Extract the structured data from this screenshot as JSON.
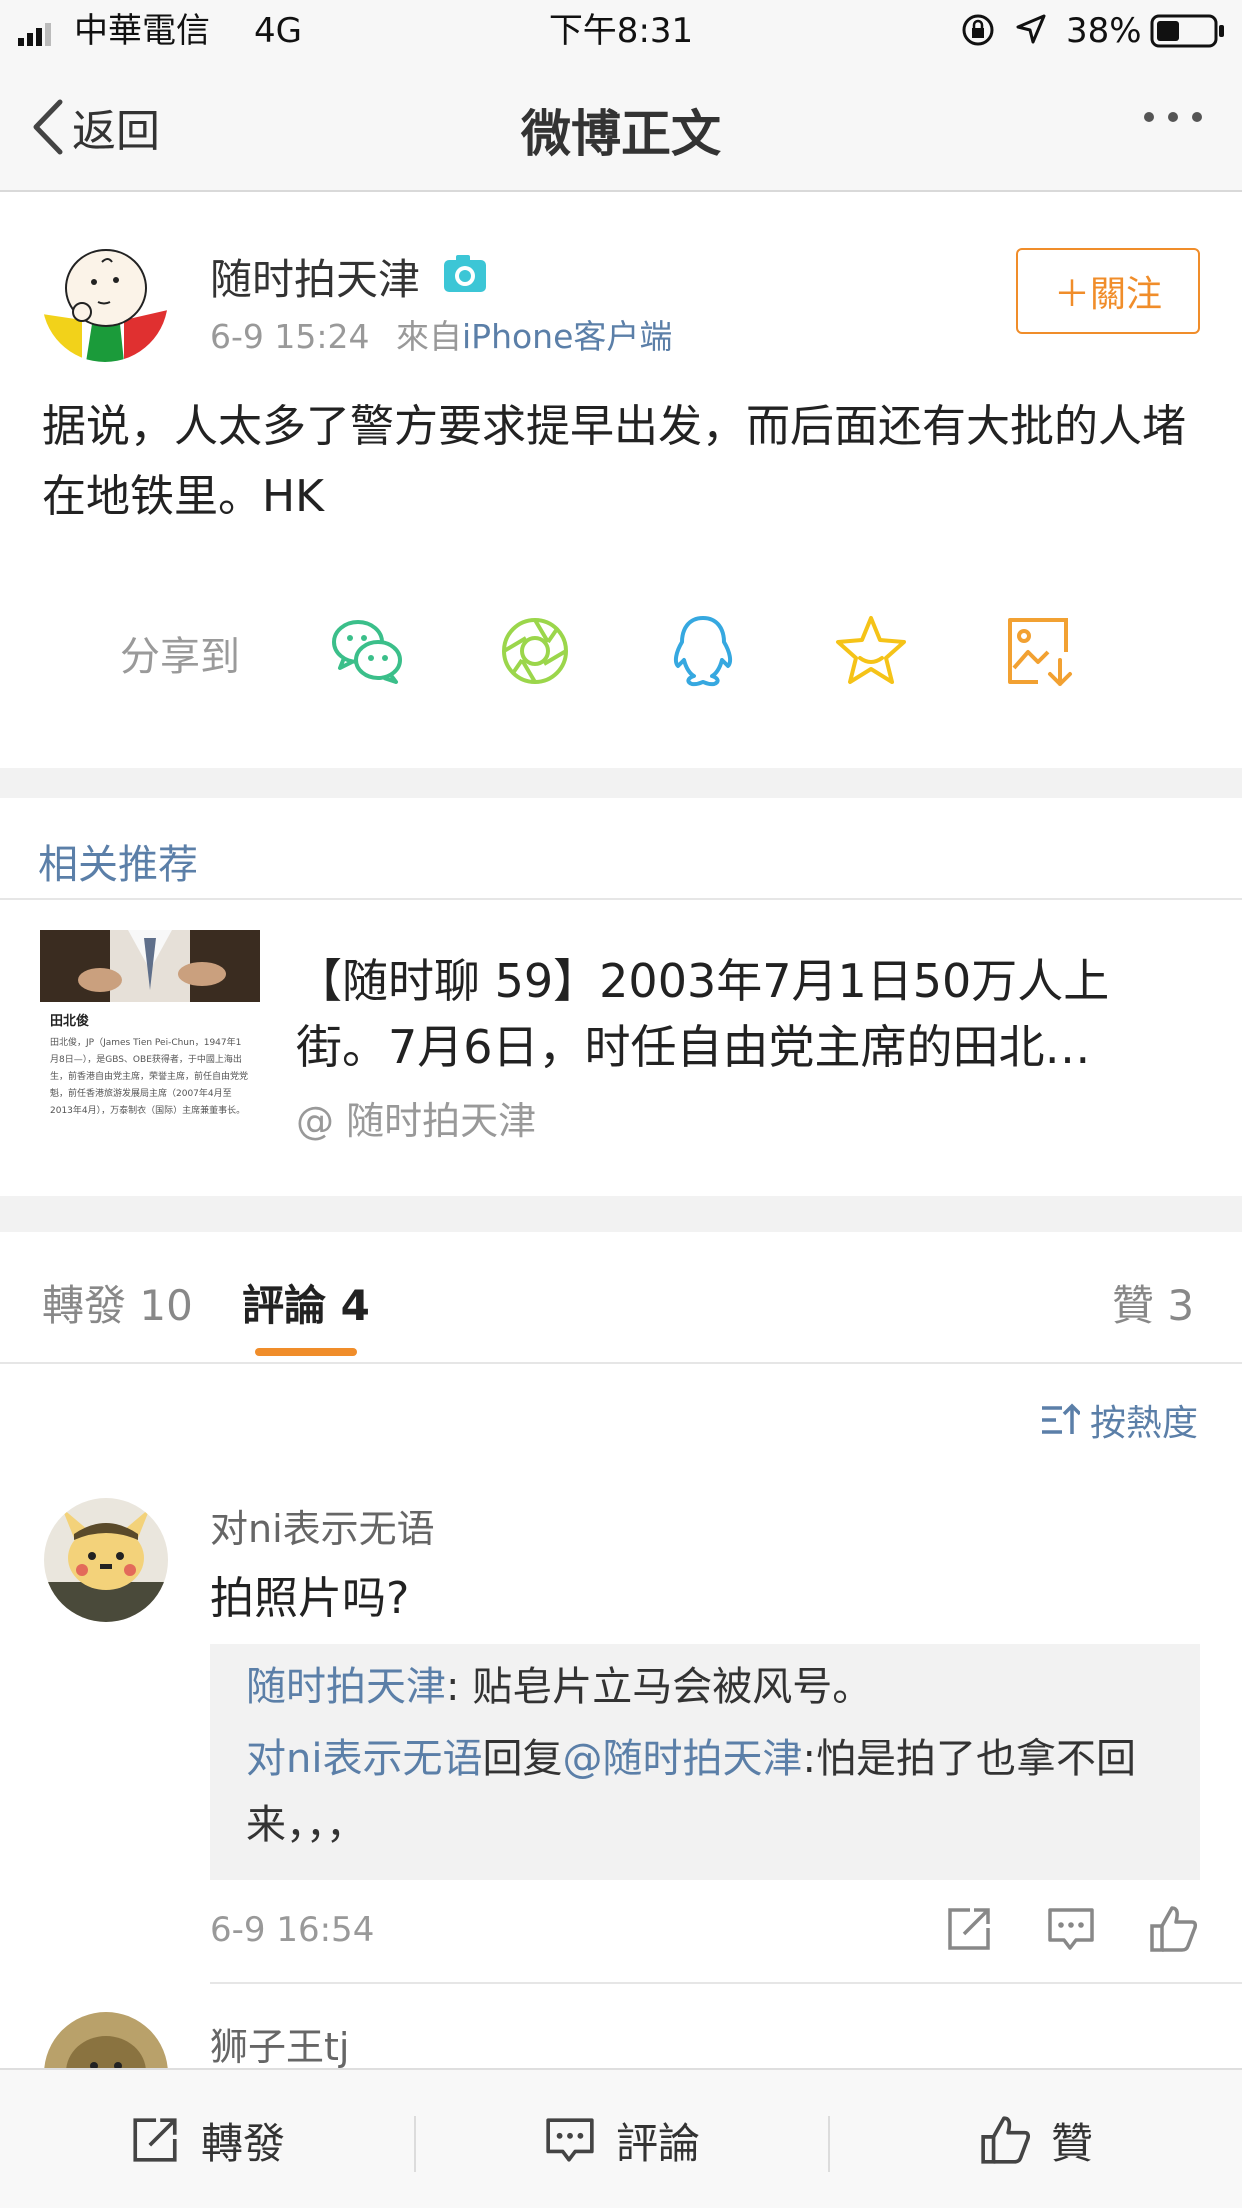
{
  "status_bar": {
    "carrier": "中華電信",
    "network": "4G",
    "time": "下午8:31",
    "battery": "38%"
  },
  "nav": {
    "back_label": "返回",
    "title": "微博正文"
  },
  "post": {
    "username": "随时拍天津",
    "time": "6-9 15:24",
    "source_prefix": "來自",
    "source": "iPhone客户端",
    "follow_label": "＋關注",
    "text": "据说，人太多了警方要求提早出发，而后面还有大批的人堵在地铁里。HK",
    "share_label": "分享到",
    "share_icons": [
      "wechat-icon",
      "moments-icon",
      "qq-icon",
      "favorite-icon",
      "save-image-icon"
    ]
  },
  "related": {
    "section_title": "相关推荐",
    "thumb_name": "田北俊",
    "thumb_text": "田北俊，JP（James Tien Pei-Chun，1947年1月8日—），是GBS、OBE获得者，于中國上海出生，前香港自由党主席，荣誉主席，前任自由党党魁，前任香港旅游发展局主席（2007年4月至2013年4月），万泰制衣（国际）主席兼董事长。",
    "title": "【随时聊 59】2003年7月1日50万人上街。7月6日，时任自由党主席的田北…",
    "author": "@ 随时拍天津"
  },
  "tabs": {
    "repost": "轉發 10",
    "comment": "評論 4",
    "like": "贊 3"
  },
  "sort_label": "按熱度",
  "comments": [
    {
      "username": "对ni表示无语",
      "text": "拍照片吗?",
      "reply1_user": "随时拍天津",
      "reply1_text": ": 贴皂片立马会被风号。",
      "reply2_user": "对ni表示无语",
      "reply2_mid": "回复",
      "reply2_at": "@随时拍天津",
      "reply2_text": ":怕是拍了也拿不回来，，，",
      "time": "6-9 16:54"
    },
    {
      "username": "狮子王tj"
    }
  ],
  "bottom_bar": {
    "repost": "轉發",
    "comment": "評論",
    "like": "贊"
  },
  "colors": {
    "accent_orange": "#f08d2a",
    "link_blue": "#5b7fa8",
    "wechat_green": "#3bbf8a",
    "moments_green": "#9bd64b",
    "qq_blue": "#36a8e0",
    "favorite_yellow": "#f5c318"
  }
}
